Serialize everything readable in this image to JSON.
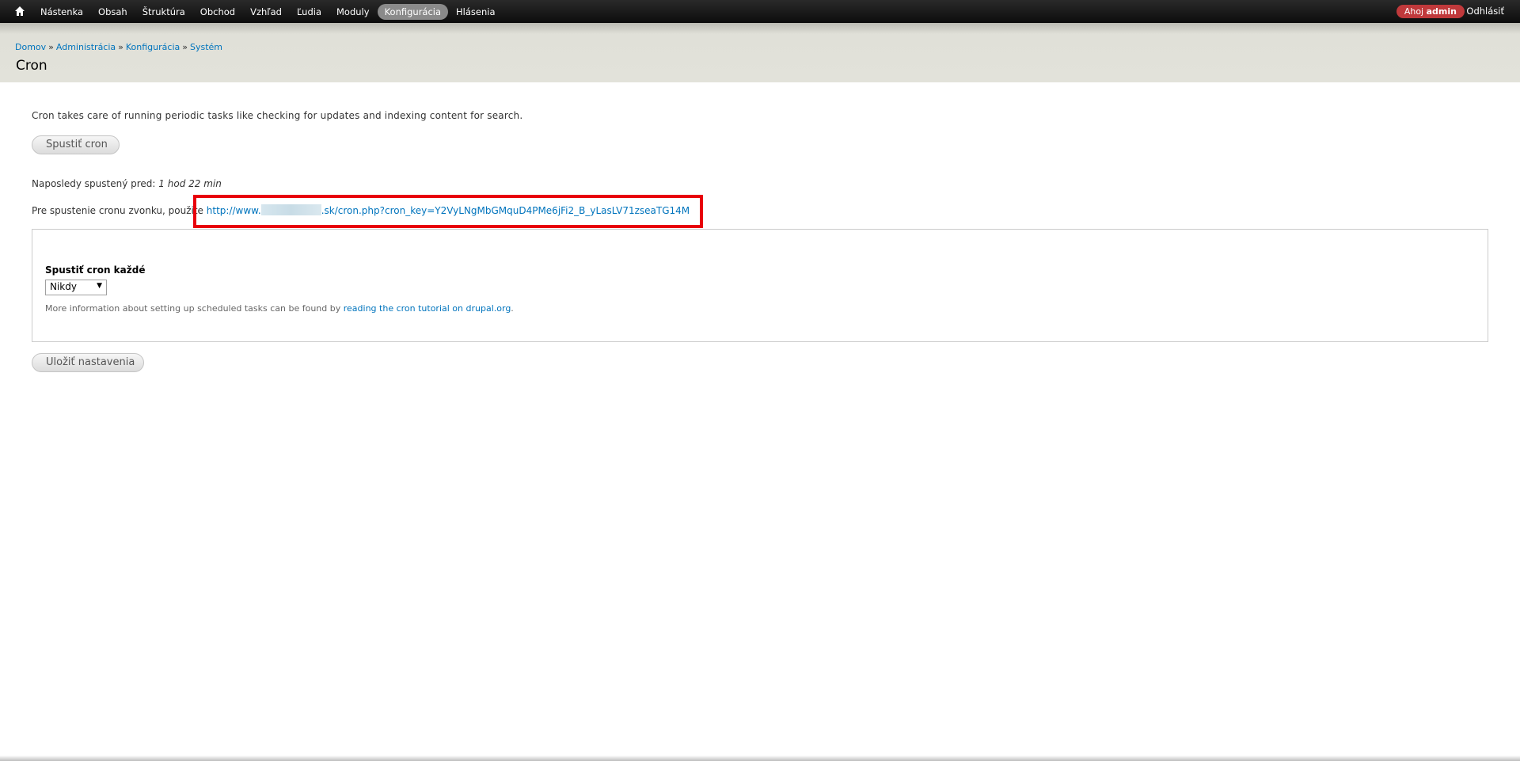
{
  "toolbar": {
    "home_icon": "home-icon",
    "menu": [
      {
        "label": "Nástenka"
      },
      {
        "label": "Obsah"
      },
      {
        "label": "Štruktúra"
      },
      {
        "label": "Obchod"
      },
      {
        "label": "Vzhľad"
      },
      {
        "label": "Ľudia"
      },
      {
        "label": "Moduly"
      },
      {
        "label": "Konfigurácia",
        "active": true
      },
      {
        "label": "Hlásenia"
      }
    ],
    "greeting": "Ahoj",
    "username": "admin",
    "logout": "Odhlásiť"
  },
  "header": {
    "breadcrumb": [
      "Domov",
      "Administrácia",
      "Konfigurácia",
      "Systém"
    ],
    "separator": "»",
    "title": "Cron"
  },
  "main": {
    "description": "Cron takes care of running periodic tasks like checking for updates and indexing content for search.",
    "run_button": "Spustiť cron",
    "last_run_label": "Naposledy spustený pred:",
    "last_run_value": "1 hod 22 min",
    "external_label": "Pre spustenie cronu zvonku, použite",
    "cron_url_prefix": "http://www.",
    "cron_url_suffix": ".sk/cron.php?cron_key=Y2VyLNgMbGMquD4PMe6jFi2_B_yLasLV71zseaTG14M",
    "settings": {
      "field_label": "Spustiť cron každé",
      "select_value": "Nikdy",
      "help_text": "More information about setting up scheduled tasks can be found by",
      "help_link": "reading the cron tutorial on drupal.org",
      "help_end": "."
    },
    "save_button": "Uložiť nastavenia"
  },
  "colors": {
    "link": "#0074bd",
    "highlight": "#e8000a",
    "user_badge": "#c0393b",
    "toolbar": "#1a1a1a",
    "header_band": "#e2e2da"
  }
}
